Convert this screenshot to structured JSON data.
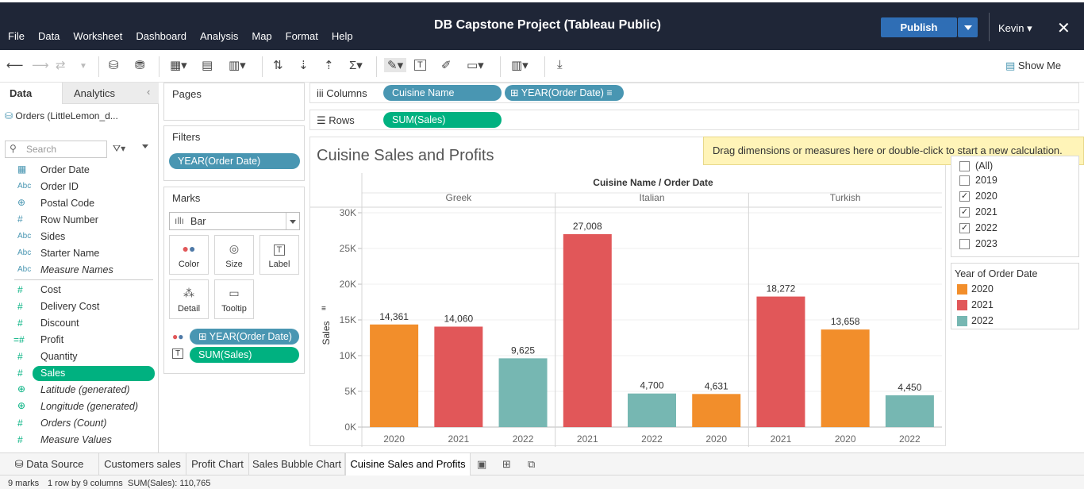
{
  "app": {
    "title": "DB Capstone Project (Tableau Public)",
    "publish_label": "Publish",
    "user": "Kevin",
    "menu": [
      "File",
      "Data",
      "Worksheet",
      "Dashboard",
      "Analysis",
      "Map",
      "Format",
      "Help"
    ]
  },
  "toolbar": {
    "show_me_label": "Show Me"
  },
  "data_pane": {
    "tab_data": "Data",
    "tab_analytics": "Analytics",
    "datasource": "Orders (LittleLemon_d...",
    "search_placeholder": "Search",
    "dimension_fields": [
      {
        "type": "date-icon",
        "label": "Order Date"
      },
      {
        "type": "Abc",
        "label": "Order ID"
      },
      {
        "type": "globe-icon",
        "label": "Postal Code"
      },
      {
        "type": "#",
        "label": "Row Number"
      },
      {
        "type": "Abc",
        "label": "Sides"
      },
      {
        "type": "Abc",
        "label": "Starter Name"
      },
      {
        "type": "Abc",
        "label": "Measure Names"
      }
    ],
    "measure_fields": [
      {
        "type": "#",
        "label": "Cost"
      },
      {
        "type": "#",
        "label": "Delivery Cost"
      },
      {
        "type": "#",
        "label": "Discount"
      },
      {
        "type": "=#",
        "label": "Profit"
      },
      {
        "type": "#",
        "label": "Quantity"
      },
      {
        "type": "#",
        "label": "Sales"
      },
      {
        "type": "globe-icon",
        "label": "Latitude (generated)"
      },
      {
        "type": "globe-icon",
        "label": "Longitude (generated)"
      },
      {
        "type": "=#",
        "label": "Orders (Count)"
      },
      {
        "type": "#",
        "label": "Measure Values"
      }
    ]
  },
  "shelves": {
    "pages_label": "Pages",
    "filters_label": "Filters",
    "filter_pill": "YEAR(Order Date)",
    "marks_label": "Marks",
    "mark_type": "Bar",
    "mark_buttons": [
      "Color",
      "Size",
      "Label",
      "Detail",
      "Tooltip"
    ],
    "marks_pill_color": "YEAR(Order Date)",
    "marks_pill_label": "SUM(Sales)",
    "columns_label": "Columns",
    "columns_pills": [
      "Cuisine Name",
      "YEAR(Order Date)"
    ],
    "rows_label": "Rows",
    "rows_pill": "SUM(Sales)"
  },
  "tooltip_banner": "Drag dimensions or measures here or double-click to start a new calculation.",
  "filter_card": {
    "items": [
      {
        "label": "(All)",
        "checked": false
      },
      {
        "label": "2019",
        "checked": false
      },
      {
        "label": "2020",
        "checked": true
      },
      {
        "label": "2021",
        "checked": true
      },
      {
        "label": "2022",
        "checked": true
      },
      {
        "label": "2023",
        "checked": false
      }
    ]
  },
  "legend": {
    "title": "Year of Order Date",
    "items": [
      {
        "label": "2020",
        "color": "#f28e2b"
      },
      {
        "label": "2021",
        "color": "#e15759"
      },
      {
        "label": "2022",
        "color": "#76b7b2"
      }
    ]
  },
  "chart_data": {
    "type": "bar",
    "title": "Cuisine Sales and Profits",
    "header": "Cuisine Name / Order Date",
    "ylabel": "Sales",
    "ylim": [
      0,
      30000
    ],
    "yticks": [
      0,
      5000,
      10000,
      15000,
      20000,
      25000,
      30000
    ],
    "ytick_labels": [
      "0K",
      "5K",
      "10K",
      "15K",
      "20K",
      "25K",
      "30K"
    ],
    "panes": [
      {
        "name": "Greek",
        "bars": [
          {
            "year": "2020",
            "value": 14361,
            "label": "14,361"
          },
          {
            "year": "2021",
            "value": 14060,
            "label": "14,060"
          },
          {
            "year": "2022",
            "value": 9625,
            "label": "9,625"
          }
        ]
      },
      {
        "name": "Italian",
        "bars": [
          {
            "year": "2021",
            "value": 27008,
            "label": "27,008"
          },
          {
            "year": "2022",
            "value": 4700,
            "label": "4,700"
          },
          {
            "year": "2020",
            "value": 4631,
            "label": "4,631"
          }
        ]
      },
      {
        "name": "Turkish",
        "bars": [
          {
            "year": "2021",
            "value": 18272,
            "label": "18,272"
          },
          {
            "year": "2020",
            "value": 13658,
            "label": "13,658"
          },
          {
            "year": "2022",
            "value": 4450,
            "label": "4,450"
          }
        ]
      }
    ],
    "colors": {
      "2020": "#f28e2b",
      "2021": "#e15759",
      "2022": "#76b7b2"
    }
  },
  "sheet_tabs": {
    "data_source": "Data Source",
    "tabs": [
      "Customers sales",
      "Profit Chart",
      "Sales Bubble Chart",
      "Cuisine Sales and Profits"
    ],
    "active": "Cuisine Sales and Profits"
  },
  "status": {
    "marks": "9 marks",
    "rows_cols": "1 row by 9 columns",
    "sum": "SUM(Sales): 110,765"
  }
}
